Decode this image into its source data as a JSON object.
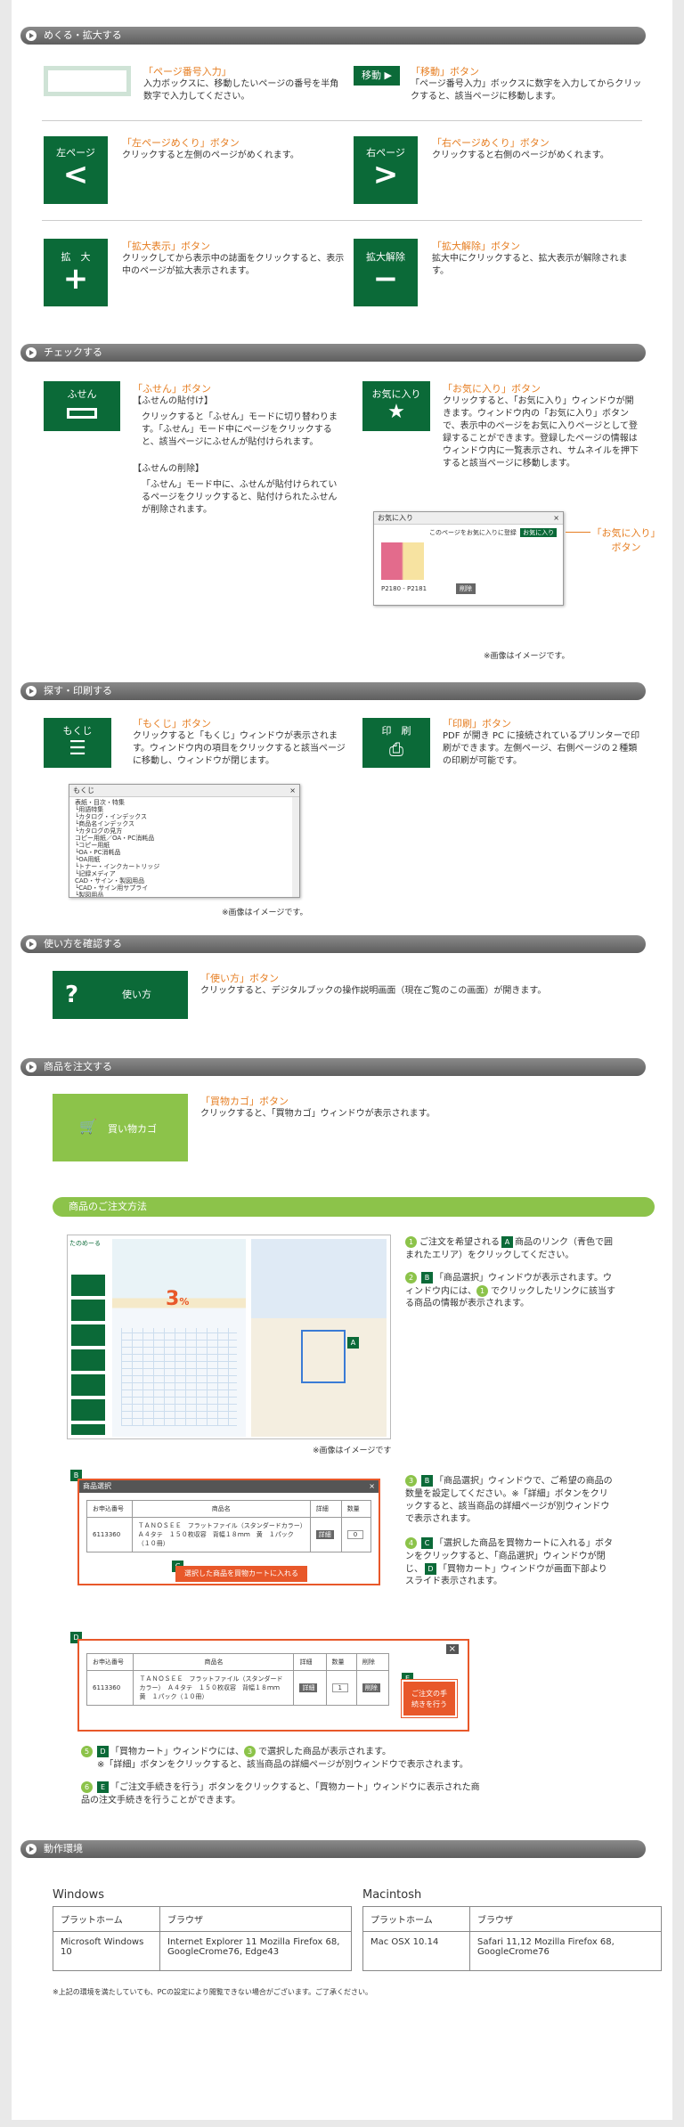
{
  "sections": {
    "navigate": "めくる・拡大する",
    "check": "チェックする",
    "search": "探す・印刷する",
    "howto": "使い方を確認する",
    "order": "商品を注文する",
    "env": "動作環境"
  },
  "page_input": {
    "title": "「ページ番号入力」",
    "desc": "入力ボックスに、移動したいページの番号を半角数字で入力してください。"
  },
  "move": {
    "btn": "移動",
    "title": "「移動」ボタン",
    "desc": "「ページ番号入力」ボックスに数字を入力してからクリックすると、該当ページに移動します。"
  },
  "left_page": {
    "btn": "左ページ",
    "glyph": "<",
    "title": "「左ページめくり」ボタン",
    "desc": "クリックすると左側のページがめくれます。"
  },
  "right_page": {
    "btn": "右ページ",
    "glyph": ">",
    "title": "「右ページめくり」ボタン",
    "desc": "クリックすると右側のページがめくれます。"
  },
  "zoom_in": {
    "btn": "拡　大",
    "glyph": "+",
    "title": "「拡大表示」ボタン",
    "desc": "クリックしてから表示中の誌面をクリックすると、表示中のページが拡大表示されます。"
  },
  "zoom_out": {
    "btn": "拡大解除",
    "glyph": "−",
    "title": "「拡大解除」ボタン",
    "desc": "拡大中にクリックすると、拡大表示が解除されます。"
  },
  "fusen": {
    "btn": "ふせん",
    "title": "「ふせん」ボタン",
    "sub1": "【ふせんの貼付け】",
    "desc1": "クリックすると「ふせん」モードに切り替わります。「ふせん」モード中にページをクリックすると、該当ページにふせんが貼付けられます。",
    "sub2": "【ふせんの削除】",
    "desc2": "「ふせん」モード中に、ふせんが貼付けられているページをクリックすると、貼付けられたふせんが削除されます。"
  },
  "fav": {
    "btn": "お気に入り",
    "title": "「お気に入り」ボタン",
    "desc": "クリックすると、「お気に入り」ウィンドウが開きます。ウィンドウ内の「お気に入り」ボタンで、表示中のページをお気に入りページとして登録することができます。登録したページの情報はウィンドウ内に一覧表示され、サムネイルを押下すると該当ページに移動します。",
    "win_title": "お気に入り",
    "win_msg": "このページをお気に入りに登録",
    "win_btn": "お気に入り",
    "pages": "P2180 - P2181",
    "del": "削除",
    "callout": "「お気に入り」ボタン",
    "note": "※画像はイメージです。"
  },
  "toc": {
    "btn": "もくじ",
    "title": "「もくじ」ボタン",
    "desc": "クリックすると「もくじ」ウィンドウが表示されます。ウィンドウ内の項目をクリックすると該当ページに移動し、ウィンドウが閉じます。",
    "win_title": "もくじ",
    "items": [
      "表紙・目次・特集",
      "└用語特集",
      "└カタログ・インデックス",
      "└商品名インデックス",
      "└カタログの見方",
      "コピー用紙／OA・PC消耗品",
      "└コピー用紙",
      "└OA・PC消耗品",
      "└OA用紙",
      "└トナー・インクカートリッジ",
      "└記録メディア",
      "CAD・サイン・製図用品",
      "└CAD・サイン用サプライ",
      "└製図用品"
    ],
    "note": "※画像はイメージです。"
  },
  "print": {
    "btn": "印　刷",
    "title": "「印刷」ボタン",
    "desc": "PDF が開き PC に接続されているプリンターで印刷ができます。左側ページ、右側ページの２種類の印刷が可能です。"
  },
  "howto": {
    "btn": "使い方",
    "title": "「使い方」ボタン",
    "desc": "クリックすると、デジタルブックの操作説明画面（現在ご覧のこの画面）が開きます。"
  },
  "cart": {
    "btn": "買い物カゴ",
    "title": "「買物カゴ」ボタン",
    "desc": "クリックすると、「買物カゴ」ウィンドウが表示されます。"
  },
  "order_flow": {
    "bar": "商品のご注文方法",
    "note": "※画像はイメージです",
    "step1": "ご注文を希望される",
    "step1b": "商品のリンク（青色で囲まれたエリア）をクリックしてください。",
    "step2": "「商品選択」ウィンドウが表示されます。ウィンドウ内には、",
    "step2b": "でクリックしたリンクに該当する商品の情報が表示されます。",
    "step3": "「商品選択」ウィンドウで、ご希望の商品の数量を設定してください。※「詳細」ボタンをクリックすると、該当商品の詳細ページが別ウィンドウで表示されます。",
    "step4a": "「選択した商品を買物カートに入れる」ボタンをクリックすると、「商品選択」ウィンドウが閉じ、",
    "step4b": "「買物カート」ウィンドウが画面下部よりスライド表示されます。",
    "step5a": "「買物カート」ウィンドウには、",
    "step5b": "で選択した商品が表示されます。",
    "step5c": "※「詳細」ボタンをクリックすると、該当商品の詳細ページが別ウィンドウで表示されます。",
    "step6": "「ご注文手続きを行う」ボタンをクリックすると、「買物カート」ウィンドウに表示された商品の注文手続きを行うことができます。",
    "select_win_title": "商品選択",
    "col_code": "お申込番号",
    "col_name": "商品名",
    "col_detail": "詳細",
    "col_qty": "数量",
    "col_del": "削除",
    "row_code": "6113360",
    "row_name": "ＴＡＮＯＳＥＥ　フラットファイル（スタンダードカラー）　Ａ４タテ　１５０枚収容　背幅１８ｍｍ　黄　１パック（１０冊）",
    "detail_btn": "詳細",
    "qty": "0",
    "qty2": "1",
    "del_btn": "削除",
    "put_btn": "選択した商品を買物カートに入れる",
    "order_btn": "ご注文の手続きを行う",
    "book_logo": "たのめーる",
    "book_big": "3",
    "book_pct": "%"
  },
  "env": {
    "win_label": "Windows",
    "mac_label": "Macintosh",
    "col_platform": "プラットホーム",
    "col_browser": "ブラウザ",
    "win_platform": "Microsoft Windows 10",
    "win_browser": "Internet Explorer 11 Mozilla Firefox 68, GoogleCrome76, Edge43",
    "mac_platform": "Mac OSX 10.14",
    "mac_browser": "Safari 11,12 Mozilla Firefox 68, GoogleCrome76",
    "footnote": "※上記の環境を満たしていても、PCの設定により閲覧できない場合がございます。ご了承ください。"
  },
  "colors": {
    "green": "#0b6a38",
    "light_green": "#8cc34a",
    "orange": "#e67e22",
    "red": "#e8582a"
  }
}
